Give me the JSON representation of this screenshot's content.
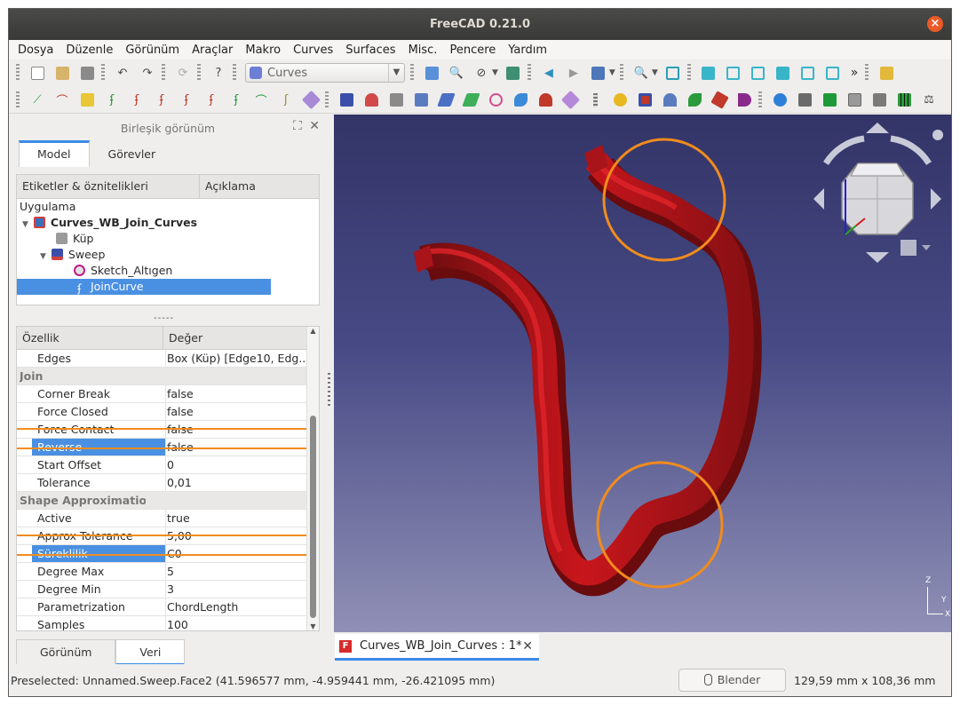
{
  "window": {
    "title": "FreeCAD 0.21.0",
    "close": "×"
  },
  "menu": [
    "Dosya",
    "Düzenle",
    "Görünüm",
    "Araçlar",
    "Makro",
    "Curves",
    "Surfaces",
    "Misc.",
    "Pencere",
    "Yardım"
  ],
  "toolbar": {
    "workbench": "Curves",
    "more": "»"
  },
  "combo": {
    "title": "Birleşik görünüm",
    "tabs": [
      "Model",
      "Görevler"
    ]
  },
  "tree": {
    "headers": [
      "Etiketler & öznitelikleri",
      "Açıklama"
    ],
    "root": "Uygulama",
    "doc": "Curves_WB_Join_Curves",
    "items": [
      "Küp",
      "Sweep",
      "Sketch_Altıgen",
      "JoinCurve"
    ]
  },
  "splitter": "-----",
  "props": {
    "headers": [
      "Özellik",
      "Değer"
    ],
    "rows": [
      {
        "name": "Edges",
        "value": "Box (Küp) [Edge10, Edg..."
      },
      {
        "group": "Join"
      },
      {
        "name": "Corner Break",
        "value": "false"
      },
      {
        "name": "Force Closed",
        "value": "false"
      },
      {
        "name": "Force Contact",
        "value": "false"
      },
      {
        "name": "Reverse",
        "value": "false",
        "selected": true
      },
      {
        "name": "Start Offset",
        "value": "0"
      },
      {
        "name": "Tolerance",
        "value": "0,01"
      },
      {
        "group": "Shape Approximation"
      },
      {
        "name": "Active",
        "value": "true"
      },
      {
        "name": "Approx Tolerance",
        "value": "5,00"
      },
      {
        "name": "Süreklilik",
        "value": "C0",
        "selected": true
      },
      {
        "name": "Degree Max",
        "value": "5"
      },
      {
        "name": "Degree Min",
        "value": "3"
      },
      {
        "name": "Parametrization",
        "value": "ChordLength"
      },
      {
        "name": "Samples",
        "value": "100"
      }
    ]
  },
  "bottom_tabs": [
    "Görünüm",
    "Veri"
  ],
  "doc_tab": {
    "label": "Curves_WB_Join_Curves : 1*",
    "close": "✕"
  },
  "status": {
    "text": "Preselected: Unnamed.Sweep.Face2 (41.596577 mm, -4.959441 mm, -26.421095 mm)",
    "nav": "Blender",
    "dims": "129,59 mm x 108,36 mm"
  },
  "axes": {
    "x": "X",
    "y": "Y",
    "z": "Z"
  },
  "colors": {
    "sweep": "#c8161c",
    "highlight": "#f18c1d",
    "selection": "#4a90e2"
  }
}
